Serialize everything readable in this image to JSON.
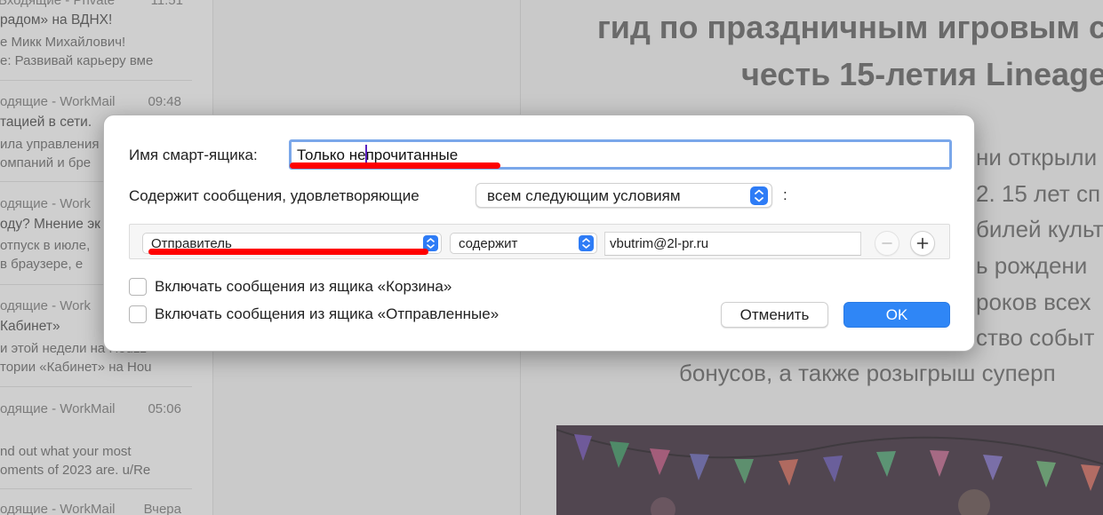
{
  "background": {
    "mail_list": [
      {
        "header": "Входящие - Private",
        "time": "11:51",
        "subject": "радом» на ВДНХ!",
        "preview": [
          "е Микк Михайлович!",
          "е: Развивай карьеру вме"
        ]
      },
      {
        "header": "одящие - WorkMail",
        "time": "09:48",
        "subject": "тацией в сети.",
        "preview": [
          "ила управления",
          "омпаний и бре"
        ]
      },
      {
        "header": "одящие - Work",
        "time": "",
        "subject": "оду? Мнение эк",
        "preview": [
          "отпуск в июле,",
          "в браузере, е"
        ]
      },
      {
        "header": "одящие - Work",
        "time": "",
        "subject": "Кабинет»",
        "preview": [
          "и этой недели на Houzz",
          "тории «Кабинет» на Hou"
        ]
      },
      {
        "header": "одящие - WorkMail",
        "time": "05:06",
        "subject": "",
        "preview": [
          "nd out what your most",
          "oments of 2023 are. u/Re"
        ]
      },
      {
        "header": "одящие - WorkMail",
        "time": "Вчера",
        "subject": "",
        "preview": []
      }
    ],
    "article": {
      "title_lines": [
        "гид по праздничным игровым с",
        "честь 15-летия Lineage"
      ],
      "body_lines": [
        "ни открыли",
        "2. 15 лет сп",
        "билей культ",
        "ь рождени",
        "роков всех",
        "ство событ",
        "бонусов, а также розыгрыш суперп"
      ]
    }
  },
  "dialog": {
    "name_label": "Имя смарт-ящика:",
    "name_value": "Только непрочитанные",
    "contains_label": "Содержит сообщения, удовлетворяющие",
    "match_select": "всем следующим условиям",
    "match_suffix": ":",
    "rule": {
      "field": "Отправитель",
      "operator": "содержит",
      "value": "vbutrim@2l-pr.ru"
    },
    "checkboxes": [
      {
        "label": "Включать сообщения из ящика «Корзина»",
        "checked": false
      },
      {
        "label": "Включать сообщения из ящика «Отправленные»",
        "checked": false
      }
    ],
    "cancel_label": "Отменить",
    "ok_label": "OK"
  },
  "colors": {
    "accent": "#2f86f6",
    "annotation": "#ff0000",
    "focus_ring": "#7aa7ea"
  },
  "icons": [
    "chevron-updown-icon",
    "minus-icon",
    "plus-icon"
  ]
}
